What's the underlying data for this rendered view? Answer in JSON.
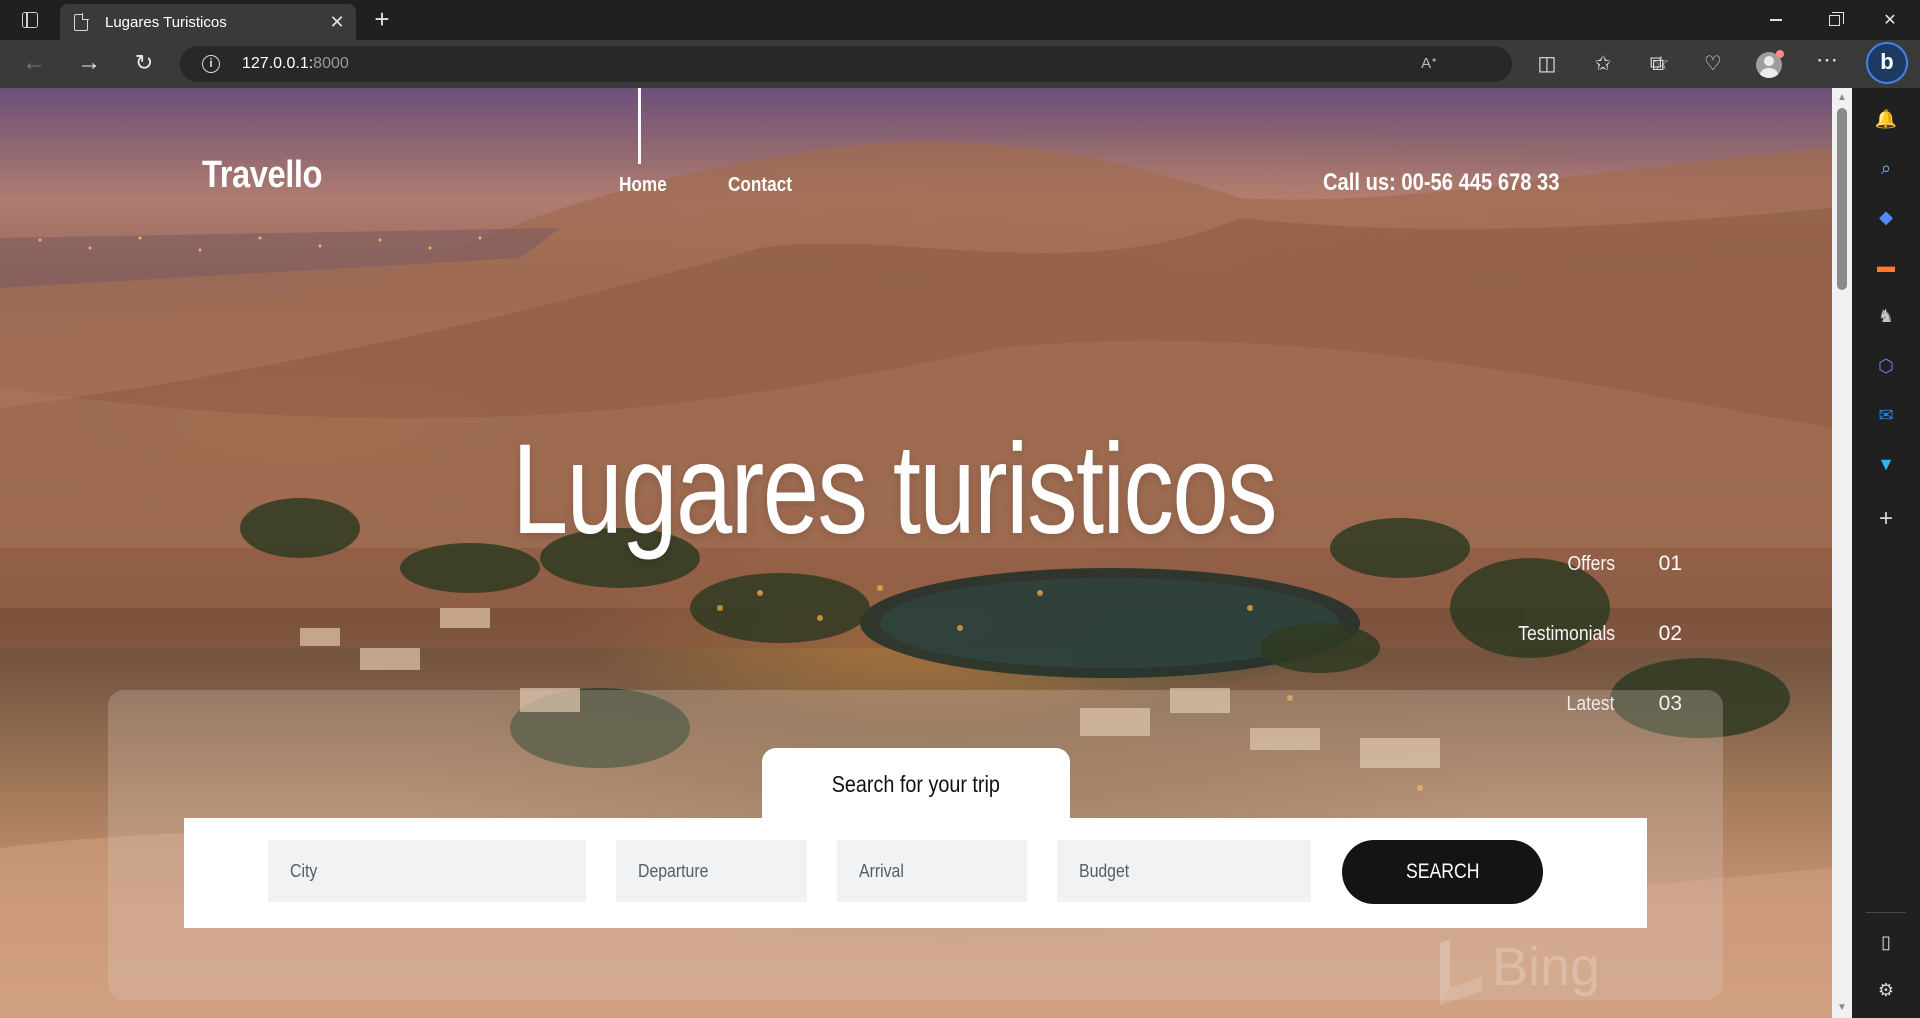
{
  "browser": {
    "tab_title": "Lugares Turisticos",
    "tab_close": "✕",
    "new_tab": "+",
    "address": {
      "host": "127.0.0.1:",
      "port": "8000",
      "info_icon": "i"
    },
    "window_controls": {
      "minimize": "minimize-icon",
      "maximize": "restore-icon",
      "close": "✕"
    },
    "toolbar_icons": [
      "read-aloud-icon",
      "favorite-star-icon",
      "split-screen-icon",
      "favorites-icon",
      "collections-icon",
      "browser-essentials-icon",
      "profile-icon",
      "more-icon"
    ],
    "bing_button": "b"
  },
  "sidebar": {
    "icons": [
      {
        "name": "notifications-icon",
        "glyph": "🔔",
        "color": "#4ea4ff"
      },
      {
        "name": "search-icon",
        "glyph": "🔍",
        "color": "#6ab7ff"
      },
      {
        "name": "shopping-icon",
        "glyph": "🏷",
        "color": "#4f8cff"
      },
      {
        "name": "tools-icon",
        "glyph": "🧰",
        "color": "#ff7a2a"
      },
      {
        "name": "games-icon",
        "glyph": "♞",
        "color": "#c6c6c6"
      },
      {
        "name": "microsoft365-icon",
        "glyph": "⬡",
        "color": "#6d7cff"
      },
      {
        "name": "outlook-icon",
        "glyph": "✉",
        "color": "#2a84e8"
      },
      {
        "name": "drop-icon",
        "glyph": "⏷",
        "color": "#34b1ff"
      },
      {
        "name": "add-icon",
        "glyph": "+",
        "color": "#d8d8d8"
      }
    ],
    "bottom_icons": [
      {
        "name": "sidebar-toggle-icon",
        "glyph": "▯"
      },
      {
        "name": "settings-icon",
        "glyph": "⚙"
      }
    ]
  },
  "site": {
    "logo": "Travello",
    "nav": {
      "home": "Home",
      "contact": "Contact"
    },
    "phone": "Call us: 00-56 445 678 33",
    "hero_title": "Lugares turisticos",
    "side_nav": [
      {
        "label": "Offers",
        "num": "01"
      },
      {
        "label": "Testimonials",
        "num": "02"
      },
      {
        "label": "Latest",
        "num": "03"
      }
    ],
    "search": {
      "tab_label": "Search for your trip",
      "city_placeholder": "City",
      "departure_placeholder": "Departure",
      "arrival_placeholder": "Arrival",
      "budget_placeholder": "Budget",
      "button_label": "SEARCH"
    },
    "watermark": "Bing"
  },
  "colors": {
    "chrome_dark": "#202020",
    "chrome_toolbar": "#3a3a3a",
    "search_button": "#141414",
    "field_bg": "#f0f2f3"
  }
}
